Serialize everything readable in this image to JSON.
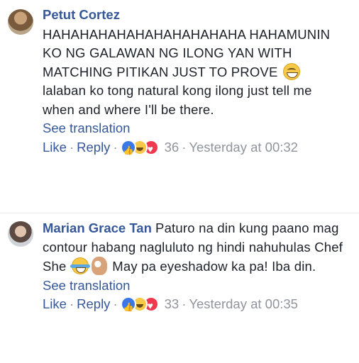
{
  "comments": [
    {
      "author": "Petut Cortez",
      "text_part1": "HAHAHAHAHAHAHAHAHAHAHA HAHAMUNIN KO NG GALAWAN NG ILONG YAN WITH MATCHING PITIKAN JUST TO PROVE",
      "text_part2": "lalaban ko tong natural kong ilong just tell me when and where I'll be there.",
      "see_translation": "See translation",
      "like_label": "Like",
      "reply_label": "Reply",
      "reaction_count": "36",
      "timestamp": "Yesterday at 00:32"
    },
    {
      "author": "Marian Grace Tan",
      "text_part1": "Paturo na din kung paano mag contour habang nagluluto ng hindi nahuhulas Chef She",
      "text_part2": "May pa eyeshadow ka pa! Iba din.",
      "see_translation": "See translation",
      "like_label": "Like",
      "reply_label": "Reply",
      "reaction_count": "33",
      "timestamp": "Yesterday at 00:35"
    }
  ],
  "icons": [
    "grinning-face-emoji",
    "tears-of-joy-emoji",
    "ok-hand-emoji",
    "like-reaction",
    "haha-reaction",
    "love-reaction"
  ],
  "colors": {
    "link": "#365899",
    "meta": "#90949c",
    "text": "#1d2129"
  }
}
